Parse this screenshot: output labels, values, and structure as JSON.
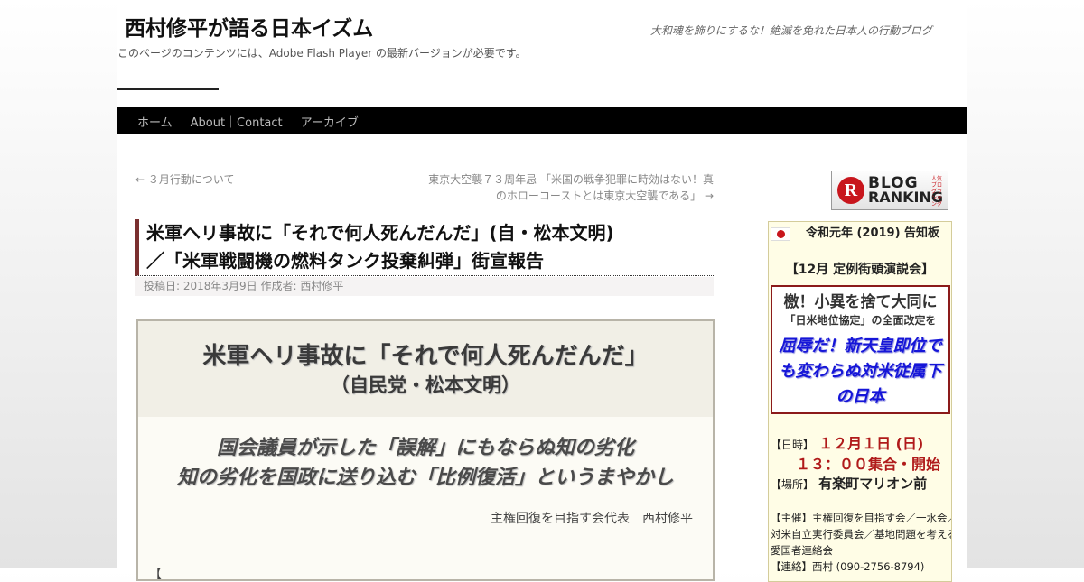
{
  "header": {
    "site_title": "西村修平が語る日本イズム",
    "site_description": "大和魂を飾りにするな！絶滅を免れた日本人の行動ブログ",
    "flash_notice": "このページのコンテンツには、Adobe Flash Player の最新バージョンが必要です。"
  },
  "nav": {
    "items": [
      {
        "label": "ホーム"
      },
      {
        "label": "About｜Contact"
      },
      {
        "label": "アーカイブ"
      }
    ]
  },
  "post_nav": {
    "prev_label": "← ３月行動について",
    "next_line1": "東京大空襲７３周年忌 「米国の戦争犯罪に時効はない！真",
    "next_line2": "のホローコーストとは東京大空襲である」 →"
  },
  "post": {
    "title_line1": "米軍ヘリ事故に「それで何人死んだんだ」(自・松本文明)",
    "title_line2": "／「米軍戦闘機の燃料タンク投棄糾弾」街宣報告",
    "meta_posted_label": "投稿日:",
    "meta_date": "2018年3月9日",
    "meta_author_label": "作成者:",
    "meta_author": "西村修平",
    "box_headline": "米軍ヘリ事故に「それで何人死んだんだ」",
    "box_subhead": "（自民党・松本文明）",
    "box_line1": "国会議員が示した「誤解」にもならぬ知の劣化",
    "box_line2": "知の劣化を国政に送り込む「比例復活」というまやかし",
    "box_signature": "主権回復を目指す会代表　西村修平",
    "box_cutoff_text": "【"
  },
  "sidebar": {
    "ranking_banner": {
      "logo_letter": "R",
      "line1": "BLOG",
      "line2": "RANKING",
      "small_text": "人気ブログランキング"
    },
    "notice": {
      "title": "令和元年 (2019) 告知板",
      "event": "【12月 定例街頭演説会】",
      "slogan_1": "檄！小異を捨て大同に",
      "slogan_2": "「日米地位協定」の全面改定を",
      "slogan_3": "屈辱だ！新天皇即位でも変わらぬ対米従属下の日本",
      "date_label": "【日時】",
      "date_value": "１２月１日 (日)",
      "time_value": "１３：００集合・開始",
      "place_label": "【場所】",
      "place_value": "有楽町マリオン前",
      "org_line1": "【主催】主権回復を目指す会／一水会／",
      "org_line2": "対米自立実行委員会／基地問題を考える",
      "org_line3": "愛国者連絡会",
      "contact_line": "【連絡】西村 (090-2756-8794)"
    }
  }
}
